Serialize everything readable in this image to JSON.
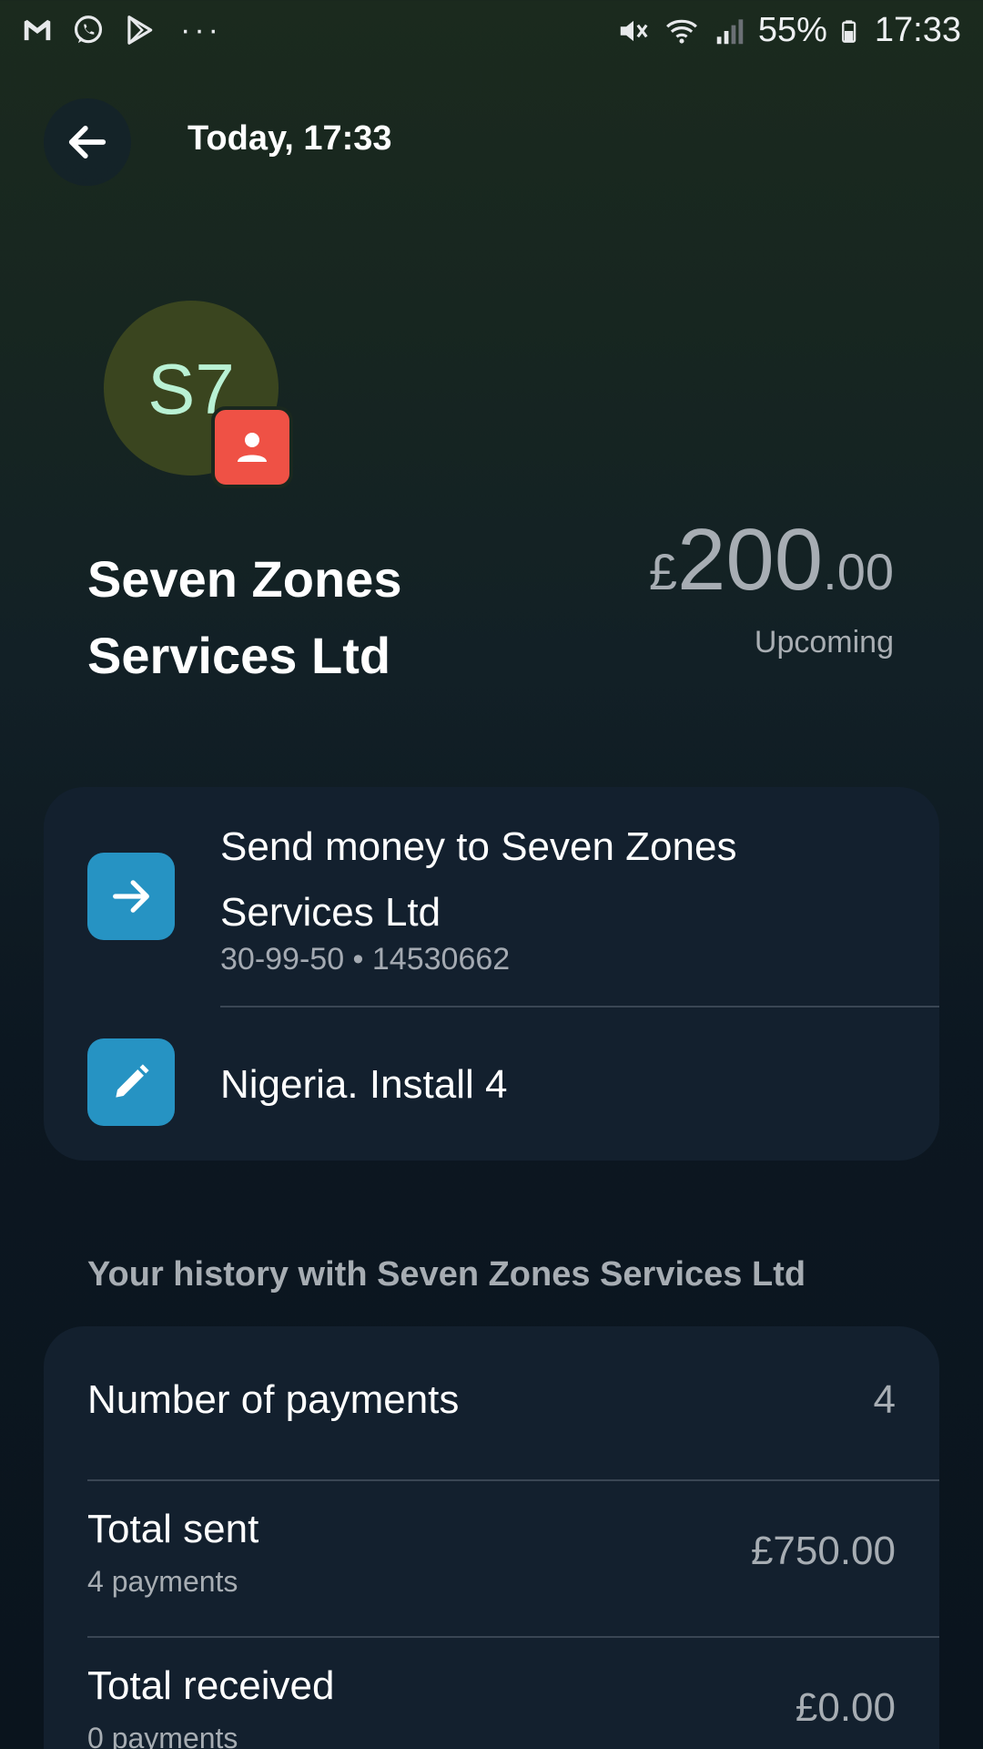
{
  "status_bar": {
    "left_icons": [
      "gmail-icon",
      "whatsapp-icon",
      "play-store-icon"
    ],
    "more": "···",
    "battery": "55%",
    "time": "17:33"
  },
  "header": {
    "title": "Today, 17:33"
  },
  "payee": {
    "initials": "S7",
    "name": "Seven Zones Services Ltd",
    "amount_currency": "£",
    "amount_main": "200",
    "amount_decimal": ".00",
    "amount_status": "Upcoming"
  },
  "actions": {
    "send_label": "Send money to Seven Zones Services Ltd",
    "send_details": "30-99-50 • 14530662",
    "note_label": "Nigeria. Install 4"
  },
  "history": {
    "heading": "Your history with Seven Zones Services Ltd",
    "rows": [
      {
        "label": "Number of payments",
        "sub": "",
        "value": "4"
      },
      {
        "label": "Total sent",
        "sub": "4 payments",
        "value": "£750.00"
      },
      {
        "label": "Total received",
        "sub": "0 payments",
        "value": "£0.00"
      }
    ]
  },
  "colors": {
    "accent_blue": "#2693c3",
    "badge_red": "#ef5145",
    "avatar_bg": "#3a451f",
    "avatar_text": "#b9f1d4",
    "card_bg": "#13202e"
  }
}
